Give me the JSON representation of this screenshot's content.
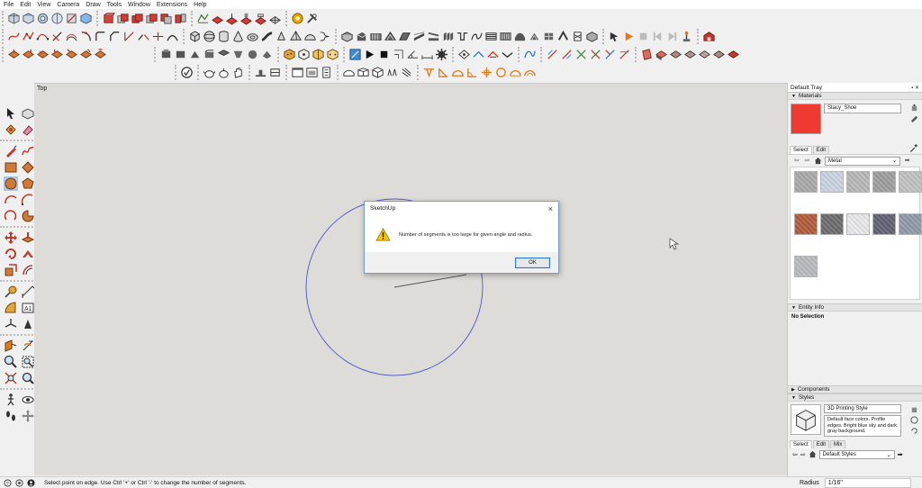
{
  "menu": [
    "File",
    "Edit",
    "View",
    "Camera",
    "Draw",
    "Tools",
    "Window",
    "Extensions",
    "Help"
  ],
  "scene": {
    "label": "Top"
  },
  "dialog": {
    "title": "SketchUp",
    "close": "×",
    "message": "Number of segments is too large for given angle and radius.",
    "ok_label": "OK"
  },
  "tray": {
    "title": "Default Tray",
    "controls": "▪ ✕",
    "materials": {
      "header": "Materials",
      "current_name": "Stacy_Shoe",
      "current_color": "#f03a2f",
      "tabs": [
        "Select",
        "Edit"
      ],
      "library": "Metal",
      "swatch_colors": [
        "#a9a9a9",
        "#c9d3e0",
        "#b7b7b7",
        "#9d9d9d",
        "#c1c1c1",
        "#b05a3a",
        "#6b6b6b",
        "#e8e8ec",
        "#5f6170",
        "#8e9aa8",
        "#b6bbc0"
      ]
    },
    "entity_info": {
      "header": "Entity Info",
      "selection": "No Selection"
    },
    "components": {
      "header": "Components"
    },
    "styles": {
      "header": "Styles",
      "current_name": "3D Printing Style",
      "description": "Default face colors. Profile edges. Bright blue sky and dark gray background.",
      "tabs": [
        "Select",
        "Edit",
        "Mix"
      ],
      "library": "Default Styles"
    }
  },
  "status": {
    "text": "Select point on edge. Use Ctrl '+' or Ctrl '-' to change the number of segments."
  },
  "measurements": {
    "label": "Radius",
    "value": "1/16\""
  },
  "colors": {
    "circle": "#5a5fcf",
    "viewport_bg": "#dedcd9",
    "accent_blue": "#2b73cf"
  }
}
